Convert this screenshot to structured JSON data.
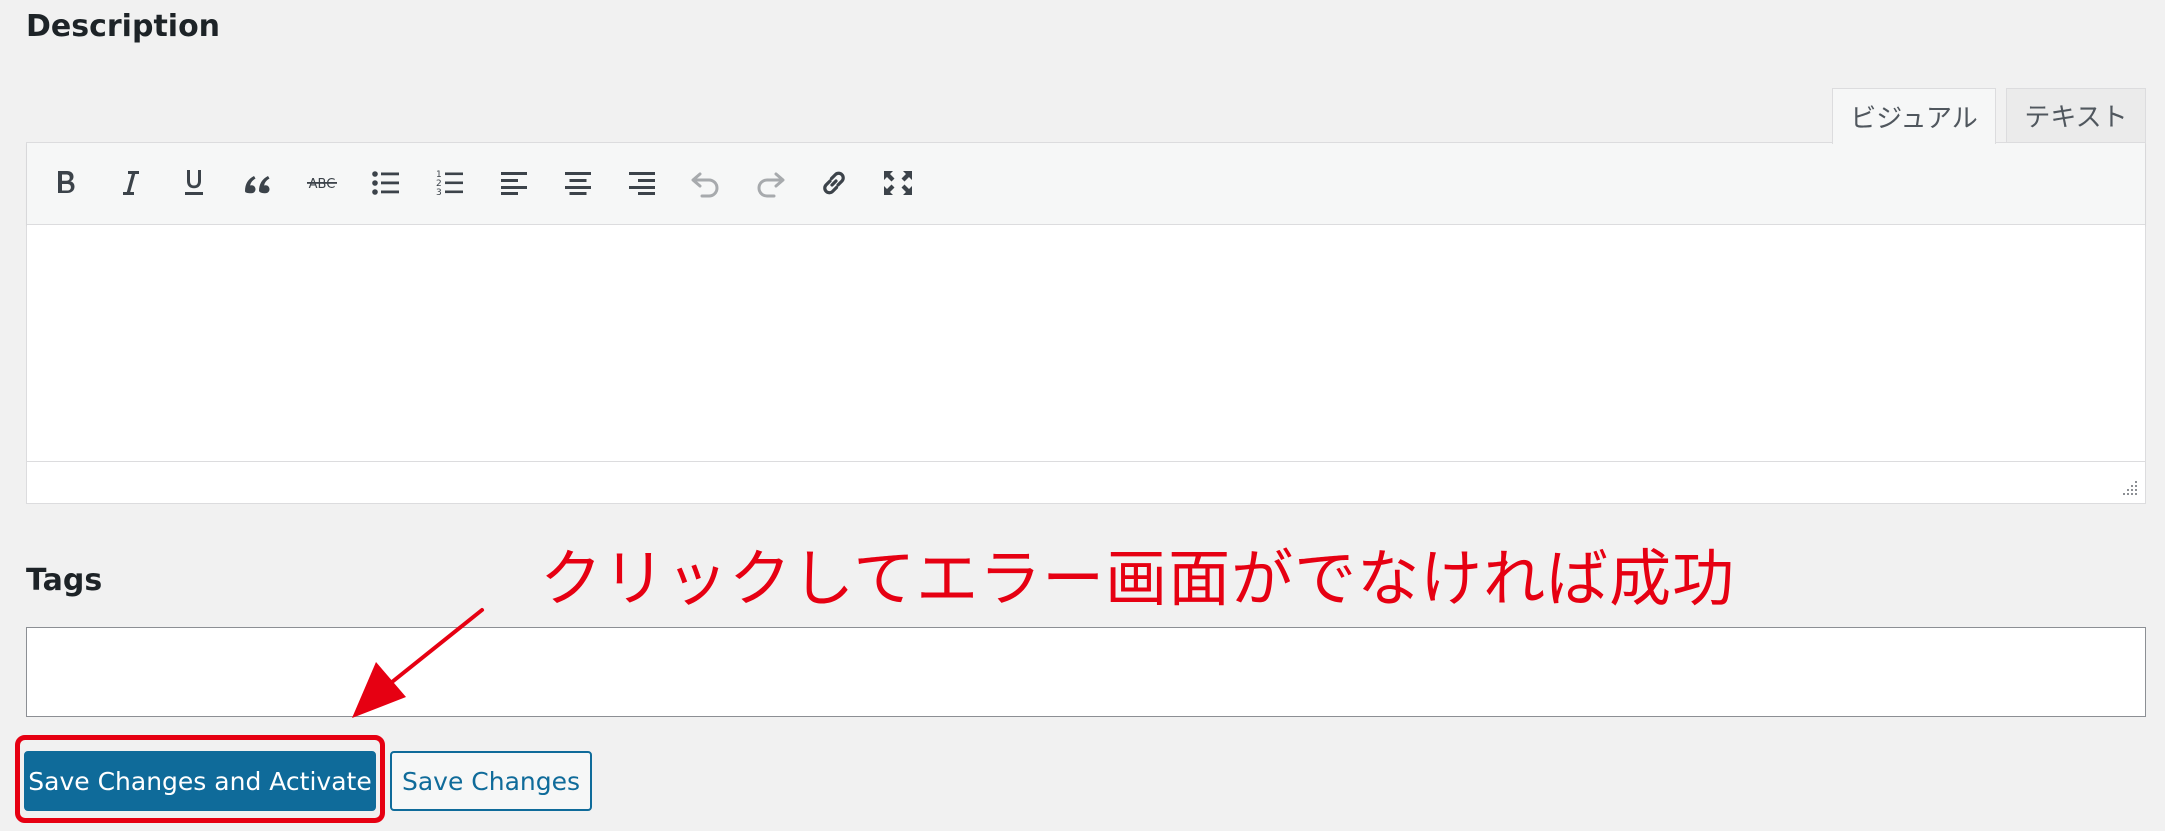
{
  "description_section": {
    "label": "Description",
    "tabs": {
      "visual": "ビジュアル",
      "text": "テキスト"
    },
    "toolbar": [
      {
        "name": "bold-button",
        "icon": "bold-icon"
      },
      {
        "name": "italic-button",
        "icon": "italic-icon"
      },
      {
        "name": "underline-button",
        "icon": "underline-icon"
      },
      {
        "name": "blockquote-button",
        "icon": "blockquote-icon"
      },
      {
        "name": "strikethrough-button",
        "icon": "strikethrough-icon",
        "glyph": "ABC"
      },
      {
        "name": "bulleted-list-button",
        "icon": "bulleted-list-icon"
      },
      {
        "name": "numbered-list-button",
        "icon": "numbered-list-icon"
      },
      {
        "name": "align-left-button",
        "icon": "align-left-icon"
      },
      {
        "name": "align-center-button",
        "icon": "align-center-icon"
      },
      {
        "name": "align-right-button",
        "icon": "align-right-icon"
      },
      {
        "name": "undo-button",
        "icon": "undo-icon"
      },
      {
        "name": "redo-button",
        "icon": "redo-icon"
      },
      {
        "name": "insert-link-button",
        "icon": "link-icon"
      },
      {
        "name": "fullscreen-button",
        "icon": "fullscreen-icon"
      }
    ],
    "content": ""
  },
  "tags_section": {
    "label": "Tags",
    "value": ""
  },
  "buttons": {
    "activate_label": "Save Changes and Activate",
    "save_label": "Save Changes"
  },
  "annotation": {
    "text": "クリックしてエラー画面がでなければ成功",
    "color": "#e60012"
  },
  "colors": {
    "primary": "#0f6b9a",
    "background": "#f1f1f1",
    "toolbar_bg": "#f6f7f7"
  }
}
